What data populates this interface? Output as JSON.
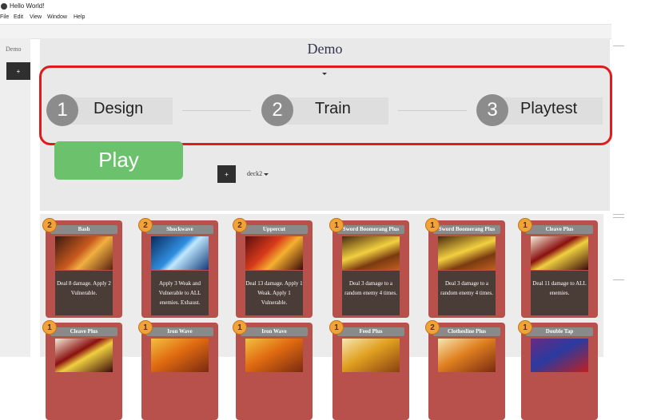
{
  "window": {
    "title": "Hello World!"
  },
  "menu": [
    "File",
    "Edit",
    "View",
    "Window",
    "Help"
  ],
  "sidebar": {
    "label": "Demo",
    "add_button": "+"
  },
  "page": {
    "title": "Demo"
  },
  "steps": [
    {
      "number": "1",
      "label": "Design"
    },
    {
      "number": "2",
      "label": "Train"
    },
    {
      "number": "3",
      "label": "Playtest"
    }
  ],
  "play_button": "Play",
  "deck": {
    "add_button": "+",
    "selected": "deck2"
  },
  "cards": [
    {
      "cost": "2",
      "name": "Bash",
      "text": "Deal 8 damage. Apply 2 Vulnerable."
    },
    {
      "cost": "2",
      "name": "Shockwave",
      "text": "Apply 3 Weak and Vulnerable to ALL enemies. Exhaust."
    },
    {
      "cost": "2",
      "name": "Uppercut",
      "text": "Deal 13 damage. Apply 1 Weak. Apply 1 Vulnerable."
    },
    {
      "cost": "1",
      "name": "Sword Boomerang Plus",
      "text": "Deal 3 damage to a random enemy 4 times."
    },
    {
      "cost": "1",
      "name": "Sword Boomerang Plus",
      "text": "Deal 3 damage to a random enemy 4 times."
    },
    {
      "cost": "1",
      "name": "Cleave Plus",
      "text": "Deal 11 damage to ALL enemies."
    },
    {
      "cost": "1",
      "name": "Cleave Plus",
      "text": ""
    },
    {
      "cost": "1",
      "name": "Iron Wave",
      "text": ""
    },
    {
      "cost": "1",
      "name": "Iron Wave",
      "text": ""
    },
    {
      "cost": "1",
      "name": "Feed Plus",
      "text": ""
    },
    {
      "cost": "2",
      "name": "Clothesline Plus",
      "text": ""
    },
    {
      "cost": "1",
      "name": "Double Tap",
      "text": ""
    }
  ],
  "colors": {
    "highlight": "#e01b1b",
    "play": "#6cc26c",
    "card": "#b8504b"
  }
}
